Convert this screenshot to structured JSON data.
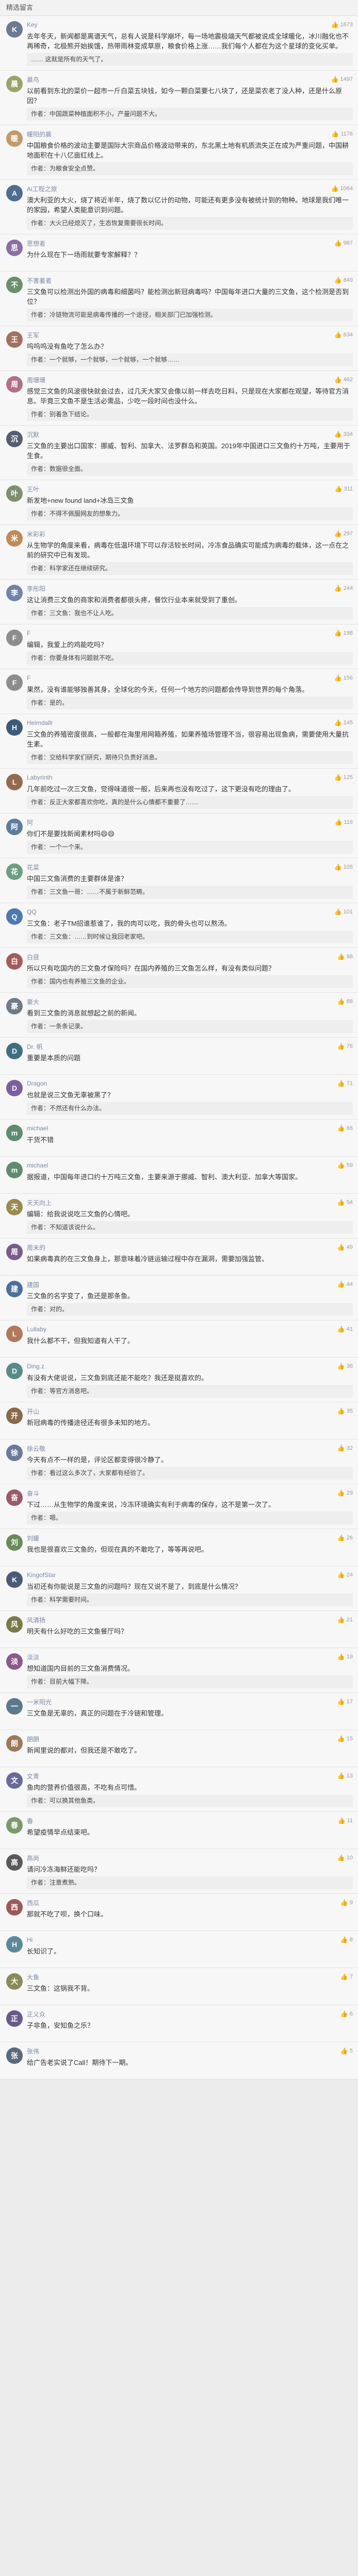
{
  "header": {
    "title": "精选留言"
  },
  "comments": [
    {
      "name": "Key",
      "likes": "1673",
      "color": "#6b7a94",
      "initial": "K",
      "text": "去年冬天，新闻都是离谱天气，总有人说是科学崩坏，每一场地震极端天气都被说成全球暖化，冰川融化也不再稀奇，北极熊开始挨饿，热带雨林变成草原，粮食价格上涨……我们每个人都在为这个星球的变化买单。",
      "reply": "…… 这就是所有的天气了。"
    },
    {
      "name": "晨鸟",
      "likes": "1497",
      "color": "#9aa36a",
      "initial": "晨",
      "text": "以前看到东北的菜价一超市一斤白菜五块钱，如今一颗白菜要七八块了，还是菜农老了没人种，还是什么原因？",
      "reply": "作者：中国蔬菜种植面积不小，产量问题不大。"
    },
    {
      "name": "暖阳的晨",
      "likes": "1176",
      "color": "#c39a6b",
      "initial": "暖",
      "text": "中国粮食价格的波动主要是国际大宗商品价格波动带来的，东北黑土地有机质流失正在成为严重问题，中国耕地面积在十八亿亩红线上。",
      "reply": "作者：为粮食安全点赞。"
    },
    {
      "name": "Ai工程之旅",
      "likes": "1064",
      "color": "#4f6d8f",
      "initial": "A",
      "text": "澳大利亚的大火，烧了将近半年，烧了数以亿计的动物，可能还有更多没有被统计到的物种。地球是我们唯一的家园，希望人类能意识到问题。",
      "reply": "作者：大火已经熄灭了，生态恢复需要很长时间。"
    },
    {
      "name": "思想者",
      "likes": "987",
      "color": "#8a6fa3",
      "initial": "思",
      "text": "为什么现在下一场雨就要专家解释？？",
      "reply": ""
    },
    {
      "name": "不害羞者",
      "likes": "849",
      "color": "#6a8f6a",
      "initial": "不",
      "text": "三文鱼可以检测出外国的病毒和细菌吗？能检测出新冠病毒吗？中国每年进口大量的三文鱼，这个检测是否到位？",
      "reply": "作者：冷链物流可能是病毒传播的一个途径，相关部门已加强检测。"
    },
    {
      "name": "王军",
      "likes": "634",
      "color": "#a37060",
      "initial": "王",
      "text": "呜呜呜没有鱼吃了怎么办？",
      "reply": "作者：一个就够，一个就够，一个就够，一个就够……"
    },
    {
      "name": "周珊珊",
      "likes": "462",
      "color": "#b0708a",
      "initial": "周",
      "text": "感觉三文鱼的风波很快就会过去，过几天大家又会像以前一样去吃日料，只是现在大家都在观望，等待官方消息。毕竟三文鱼不是生活必需品，少吃一段时间也没什么。",
      "reply": "作者：别着急下结论。"
    },
    {
      "name": "沉默",
      "likes": "334",
      "color": "#555e70",
      "initial": "沉",
      "text": "三文鱼的主要出口国家：挪威、智利、加拿大、法罗群岛和英国。2019年中国进口三文鱼约十万吨，主要用于生食。",
      "reply": "作者：数据很全面。"
    },
    {
      "name": "王叶",
      "likes": "311",
      "color": "#7c9070",
      "initial": "叶",
      "text": "新发地+new found land+冰岛三文鱼",
      "reply": "作者：不得不佩服网友的想象力。"
    },
    {
      "name": "米彩彩",
      "likes": "297",
      "color": "#c08a5c",
      "initial": "米",
      "text": "从生物学的角度来看，病毒在低温环境下可以存活较长时间，冷冻食品确实可能成为病毒的载体，这一点在之前的研究中已有发现。",
      "reply": "作者：科学家还在继续研究。"
    },
    {
      "name": "李彤阳",
      "likes": "244",
      "color": "#6f84a8",
      "initial": "李",
      "text": "这让消费三文鱼的商家和消费者都很头疼，餐饮行业本来就受到了重创。",
      "reply": "作者：三文鱼：我也不让人吃。"
    },
    {
      "name": "F",
      "likes": "198",
      "color": "#8d8d8d",
      "initial": "F",
      "text": "编辑，我爱上的鸡能吃吗？",
      "reply": "作者：你要身体有问题就不吃。"
    },
    {
      "name": "F",
      "likes": "156",
      "color": "#8d8d8d",
      "initial": "F",
      "text": "果然，没有谁能够独善其身，全球化的今天，任何一个地方的问题都会传导到世界的每个角落。",
      "reply": "作者：是的。"
    },
    {
      "name": "Heimdallr",
      "likes": "145",
      "color": "#3d5a7a",
      "initial": "H",
      "text": "三文鱼的养殖密度很高，一般都在海里用网箱养殖，如果养殖场管理不当，很容易出现鱼病，需要使用大量抗生素。",
      "reply": "作者：交给科学家们研究，期待只负责好消息。"
    },
    {
      "name": "Labyrinth",
      "likes": "125",
      "color": "#946a4e",
      "initial": "L",
      "text": "几年前吃过一次三文鱼，觉得味道很一般，后来再也没有吃过了，这下更没有吃的理由了。",
      "reply": "作者：反正大家都喜欢你吃，真的是什么心情都不重要了……"
    },
    {
      "name": "阿",
      "likes": "116",
      "color": "#5e7c9b",
      "initial": "阿",
      "text": "你们不是要找新闻素材吗😄😄",
      "reply": "作者：一个一个来。"
    },
    {
      "name": "花菜",
      "likes": "105",
      "color": "#6a9f80",
      "initial": "花",
      "text": "中国三文鱼消费的主要群体是谁？",
      "reply": "作者：三文鱼一哥：……不属于新鲜范畴。"
    },
    {
      "name": "QQ",
      "likes": "101",
      "color": "#4c79b0",
      "initial": "Q",
      "text": "三文鱼：老子TM招谁惹谁了，我的肉可以吃，我的骨头也可以熬汤。",
      "reply": "作者：三文鱼：……到时候让我回老家吧。"
    },
    {
      "name": "白昼",
      "likes": "98",
      "color": "#a35c5c",
      "initial": "白",
      "text": "所以只有吃国内的三文鱼才保险吗？在国内养殖的三文鱼怎么样，有没有类似问题？",
      "reply": "作者：国内也有养殖三文鱼的企业。"
    },
    {
      "name": "豪大",
      "likes": "88",
      "color": "#6d7c89",
      "initial": "豪",
      "text": "看到三文鱼的消息就想起之前的新闻。",
      "reply": "作者：一条条记录。"
    },
    {
      "name": "Dr. 帆",
      "likes": "76",
      "color": "#3f6f80",
      "initial": "D",
      "text": "重要是本质的问题",
      "reply": ""
    },
    {
      "name": "Dragon",
      "likes": "71",
      "color": "#7c5f9c",
      "initial": "D",
      "text": "也就是说三文鱼无辜被黑了？",
      "reply": "作者：不然还有什么办法。"
    },
    {
      "name": "michael",
      "likes": "66",
      "color": "#5f8c6f",
      "initial": "m",
      "text": "干货不错",
      "reply": ""
    },
    {
      "name": "michael",
      "likes": "59",
      "color": "#5f8c6f",
      "initial": "m",
      "text": "据报道，中国每年进口约十万吨三文鱼，主要来源于挪威、智利、澳大利亚、加拿大等国家。",
      "reply": ""
    },
    {
      "name": "天天向上",
      "likes": "54",
      "color": "#9b8a4e",
      "initial": "天",
      "text": "编辑：给我说说吃三文鱼的心情吧。",
      "reply": "作者：不知道该说什么。"
    },
    {
      "name": "周末的",
      "likes": "49",
      "color": "#7a5c8a",
      "initial": "周",
      "text": "如果病毒真的在三文鱼身上，那意味着冷链运输过程中存在漏洞，需要加强监管。",
      "reply": ""
    },
    {
      "name": "建国",
      "likes": "44",
      "color": "#4d6f9c",
      "initial": "建",
      "text": "三文鱼的名字变了，鱼还是那条鱼。",
      "reply": "作者：对的。"
    },
    {
      "name": "Lullaby",
      "likes": "41",
      "color": "#b07a5a",
      "initial": "L",
      "text": "我什么都不干，但我知道有人干了。",
      "reply": ""
    },
    {
      "name": "Ding.z",
      "likes": "38",
      "color": "#5a8a8a",
      "initial": "D",
      "text": "有没有大佬说说，三文鱼到底还能不能吃？我还是挺喜欢的。",
      "reply": "作者：等官方消息吧。"
    },
    {
      "name": "开山",
      "likes": "35",
      "color": "#8a6a4a",
      "initial": "开",
      "text": "新冠病毒的传播途径还有很多未知的地方。",
      "reply": ""
    },
    {
      "name": "徐云敬",
      "likes": "32",
      "color": "#6a7a9a",
      "initial": "徐",
      "text": "今天有点不一样的是，评论区都变得很冷静了。",
      "reply": "作者：看过这么多次了，大家都有经验了。"
    },
    {
      "name": "奋斗",
      "likes": "29",
      "color": "#9a5a6a",
      "initial": "奋",
      "text": "下过……从生物学的角度来说，冷冻环境确实有利于病毒的保存，这不是第一次了。",
      "reply": "作者：嗯。"
    },
    {
      "name": "刘媛",
      "likes": "26",
      "color": "#6a8a5a",
      "initial": "刘",
      "text": "我也是很喜欢三文鱼的，但现在真的不敢吃了，等等再说吧。",
      "reply": ""
    },
    {
      "name": "KingofStar",
      "likes": "24",
      "color": "#4a5a7a",
      "initial": "K",
      "text": "当初还有你能说是三文鱼的问题吗？现在又说不是了，到底是什么情况？",
      "reply": "作者：科学需要时间。"
    },
    {
      "name": "风清扬",
      "likes": "21",
      "color": "#7a7a4a",
      "initial": "风",
      "text": "明天有什么好吃的三文鱼餐厅吗？",
      "reply": ""
    },
    {
      "name": "淡淡",
      "likes": "19",
      "color": "#8a5a8a",
      "initial": "淡",
      "text": "想知道国内目前的三文鱼消费情况。",
      "reply": "作者：目前大幅下降。"
    },
    {
      "name": "一米阳光",
      "likes": "17",
      "color": "#5a7a8a",
      "initial": "一",
      "text": "三文鱼是无辜的，真正的问题在于冷链和管理。",
      "reply": ""
    },
    {
      "name": "朗朗",
      "likes": "15",
      "color": "#9a7a5a",
      "initial": "朗",
      "text": "新闻里说的都对，但我还是不敢吃了。",
      "reply": ""
    },
    {
      "name": "文青",
      "likes": "13",
      "color": "#6a6a9a",
      "initial": "文",
      "text": "鱼肉的营养价值很高，不吃有点可惜。",
      "reply": "作者：可以换其他鱼类。"
    },
    {
      "name": "春",
      "likes": "11",
      "color": "#7a9a6a",
      "initial": "春",
      "text": "希望疫情早点结束吧。",
      "reply": ""
    },
    {
      "name": "高尚",
      "likes": "10",
      "color": "#5a5a5a",
      "initial": "高",
      "text": "请问冷冻海鲜还能吃吗？",
      "reply": "作者：注意煮熟。"
    },
    {
      "name": "西瓜",
      "likes": "9",
      "color": "#9a5a5a",
      "initial": "西",
      "text": "那就不吃了呗，换个口味。",
      "reply": ""
    },
    {
      "name": "Hi",
      "likes": "8",
      "color": "#5a8a9a",
      "initial": "H",
      "text": "长知识了。",
      "reply": ""
    },
    {
      "name": "大鱼",
      "likes": "7",
      "color": "#8a8a5a",
      "initial": "大",
      "text": "三文鱼：这锅我不背。",
      "reply": ""
    },
    {
      "name": "正义众",
      "likes": "6",
      "color": "#6a5a8a",
      "initial": "正",
      "text": "子非鱼，安知鱼之乐？",
      "reply": ""
    },
    {
      "name": "张伟",
      "likes": "5",
      "color": "#5a6a7a",
      "initial": "张",
      "text": "给广告老实说了Call！期待下一期。",
      "reply": ""
    }
  ]
}
